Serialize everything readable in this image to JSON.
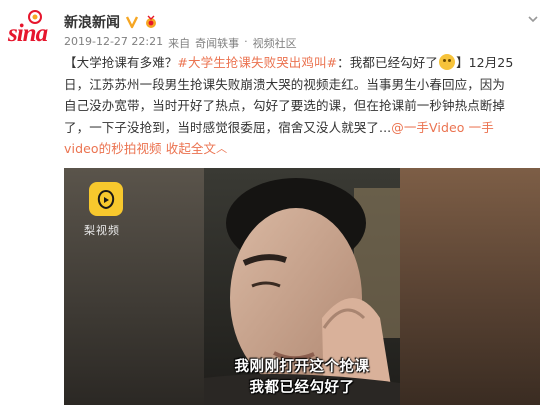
{
  "author": {
    "name": "新浪新闻",
    "verified": true,
    "logo_text": "sina"
  },
  "meta": {
    "timestamp": "2019-12-27 22:21",
    "source_prefix": "来自",
    "source": "奇闻轶事",
    "separator": "·",
    "category": "视频社区"
  },
  "post": {
    "open_bracket": "【",
    "lead": "大学抢课有多难？",
    "hashtag": "#大学生抢课失败哭出鸡叫#",
    "lead2": "：我都已经勾好了",
    "close_date": "】12月25",
    "line2": "日，江苏苏州一段男生抢课失败崩溃大哭的视频走红。当事男生小春回应，因为",
    "line3": "自己没办宽带，当时开好了热点，勾好了要选的课，但在抢课前一秒钟热点断掉",
    "line4a": "了，一下子没抢到，当时感觉很委屈，宿舍又没人就哭了...",
    "mention": "@一手Video",
    "mention2": "一手",
    "line5a": "video的秒拍视频",
    "expand": "收起全文"
  },
  "video": {
    "watermark_label": "梨视频",
    "subtitle_line1": "我刚刚打开这个抢课",
    "subtitle_line2": "我都已经勾好了"
  },
  "colors": {
    "brand": "#e6162d",
    "link": "#eb7350",
    "verified": "#f6a623",
    "meta": "#808080"
  },
  "icons": [
    "sina-logo-icon",
    "verified-icon",
    "medal-icon",
    "chevron-down-icon",
    "emoji-icon",
    "expand-arrow-icon",
    "lishipin-logo-icon"
  ]
}
